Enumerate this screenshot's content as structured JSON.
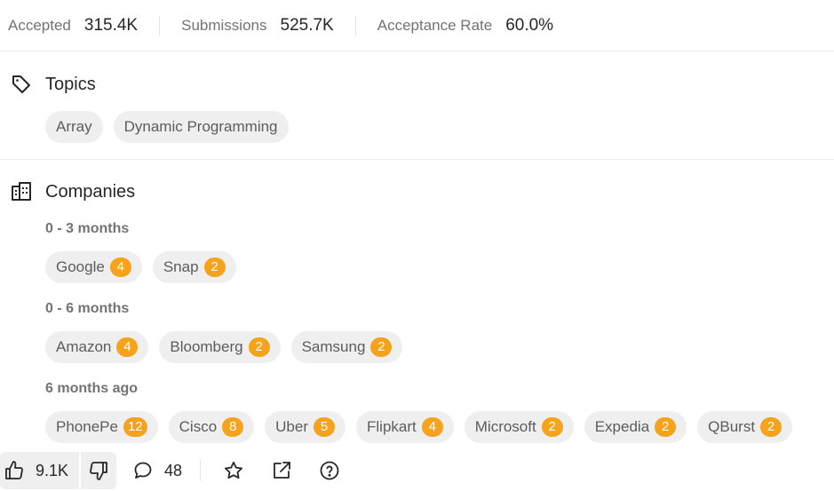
{
  "stats": {
    "accepted_label": "Accepted",
    "accepted_value": "315.4K",
    "submissions_label": "Submissions",
    "submissions_value": "525.7K",
    "rate_label": "Acceptance Rate",
    "rate_value": "60.0%"
  },
  "topics": {
    "title": "Topics",
    "icon": "tag-icon",
    "items": [
      "Array",
      "Dynamic Programming"
    ]
  },
  "companies": {
    "title": "Companies",
    "icon": "building-icon",
    "groups": [
      {
        "period": "0 - 3 months",
        "items": [
          {
            "name": "Google",
            "count": "4"
          },
          {
            "name": "Snap",
            "count": "2"
          }
        ]
      },
      {
        "period": "0 - 6 months",
        "items": [
          {
            "name": "Amazon",
            "count": "4"
          },
          {
            "name": "Bloomberg",
            "count": "2"
          },
          {
            "name": "Samsung",
            "count": "2"
          }
        ]
      },
      {
        "period": "6 months ago",
        "items": [
          {
            "name": "PhonePe",
            "count": "12"
          },
          {
            "name": "Cisco",
            "count": "8"
          },
          {
            "name": "Uber",
            "count": "5"
          },
          {
            "name": "Flipkart",
            "count": "4"
          },
          {
            "name": "Microsoft",
            "count": "2"
          },
          {
            "name": "Expedia",
            "count": "2"
          },
          {
            "name": "QBurst",
            "count": "2"
          }
        ]
      }
    ]
  },
  "actions": {
    "likes": "9.1K",
    "comments": "48"
  },
  "colors": {
    "badge": "#f5a31a",
    "chip_bg": "#efefef"
  }
}
